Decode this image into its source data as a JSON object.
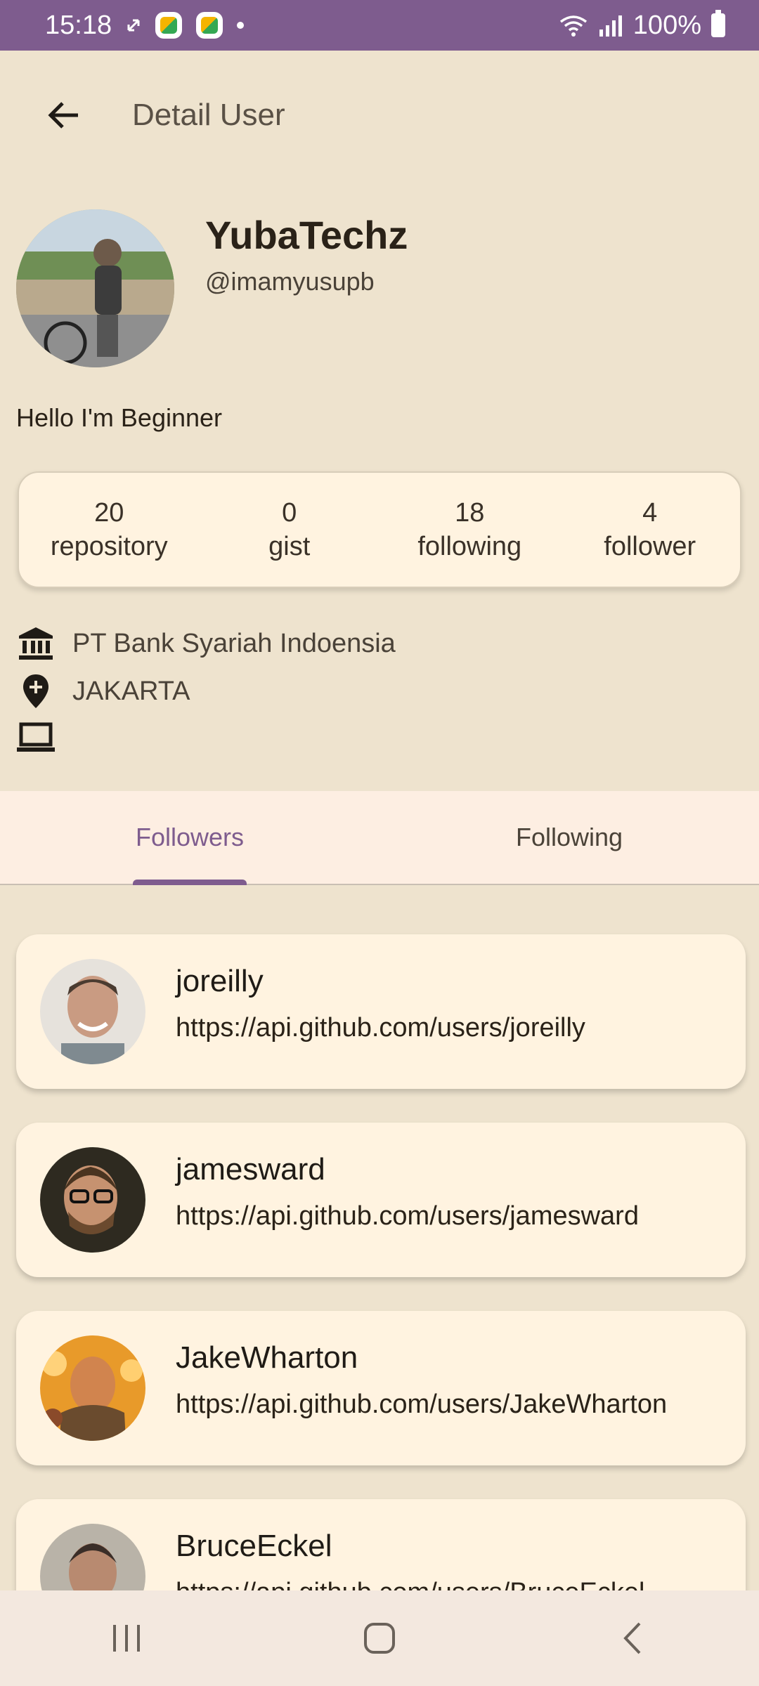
{
  "status_bar": {
    "time": "15:18",
    "battery": "100%"
  },
  "app_bar": {
    "title": "Detail User"
  },
  "profile": {
    "name": "YubaTechz",
    "handle": "@imamyusupb",
    "bio": "Hello I'm Beginner"
  },
  "stats": [
    {
      "value": "20",
      "label": "repository"
    },
    {
      "value": "0",
      "label": "gist"
    },
    {
      "value": "18",
      "label": "following"
    },
    {
      "value": "4",
      "label": "follower"
    }
  ],
  "info": {
    "company": "PT Bank Syariah Indoensia",
    "location": "JAKARTA",
    "blog": ""
  },
  "tabs": [
    {
      "label": "Followers",
      "active": true
    },
    {
      "label": "Following",
      "active": false
    }
  ],
  "users": [
    {
      "name": "joreilly",
      "url": "https://api.github.com/users/joreilly"
    },
    {
      "name": "jamesward",
      "url": "https://api.github.com/users/jamesward"
    },
    {
      "name": "JakeWharton",
      "url": "https://api.github.com/users/JakeWharton"
    },
    {
      "name": "BruceEckel",
      "url": "https://api.github.com/users/BruceEckel"
    }
  ],
  "colors": {
    "accent": "#7E5C8E",
    "background": "#EEE3CE",
    "card": "#FFF3E0"
  }
}
